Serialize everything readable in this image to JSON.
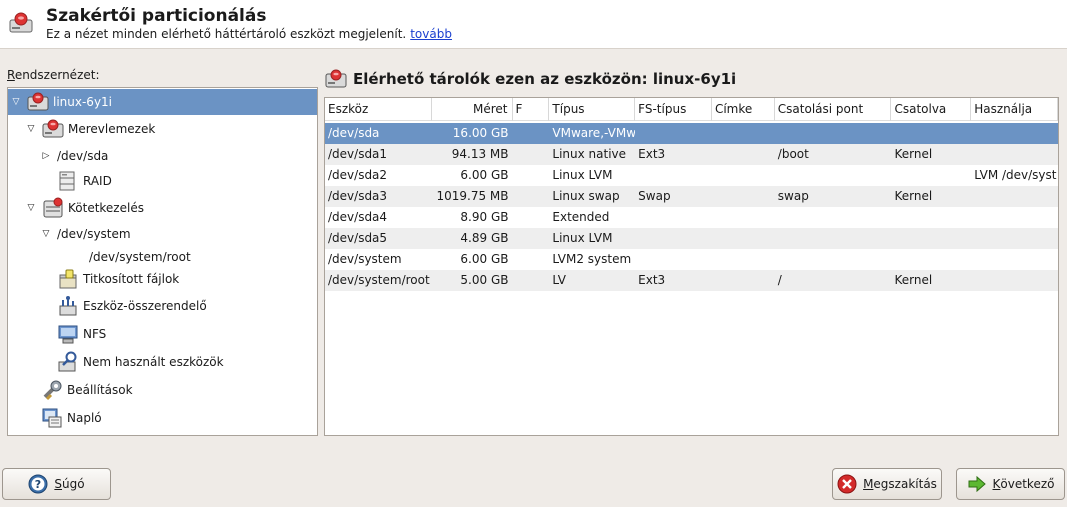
{
  "header": {
    "title": "Szakértői particionálás",
    "description": "Ez a nézet minden elérhető háttértároló eszközt megjelenít.",
    "more_link": "tovább"
  },
  "left": {
    "label_first": "R",
    "label_rest": "endszernézet:",
    "tree": [
      {
        "label": "linux-6y1i",
        "icon": "harddisk-icon",
        "expander": "expanded",
        "selected": true
      },
      {
        "label": "Merevlemezek",
        "icon": "harddisk-icon",
        "expander": "expanded"
      },
      {
        "label": "/dev/sda",
        "icon": "",
        "expander": "collapsed"
      },
      {
        "label": "RAID",
        "icon": "raid-icon",
        "expander": ""
      },
      {
        "label": "Kötetkezelés",
        "icon": "volume-manager-icon",
        "expander": "expanded"
      },
      {
        "label": "/dev/system",
        "icon": "",
        "expander": "expanded"
      },
      {
        "label": "/dev/system/root",
        "icon": "",
        "expander": ""
      },
      {
        "label": "Titkosított fájlok",
        "icon": "encrypted-files-icon",
        "expander": ""
      },
      {
        "label": "Eszköz-összerendelő",
        "icon": "device-mapper-icon",
        "expander": ""
      },
      {
        "label": "NFS",
        "icon": "nfs-icon",
        "expander": ""
      },
      {
        "label": "Nem használt eszközök",
        "icon": "unused-devices-icon",
        "expander": ""
      },
      {
        "label": "Beállítások",
        "icon": "settings-icon",
        "expander": ""
      },
      {
        "label": "Napló",
        "icon": "log-icon",
        "expander": ""
      }
    ]
  },
  "right": {
    "title": "Elérhető tárolók ezen az eszközön: linux-6y1i",
    "columns": [
      "Eszköz",
      "Méret",
      "F",
      "Típus",
      "FS-típus",
      "Címke",
      "Csatolási pont",
      "Csatolva",
      "Használja"
    ],
    "rows": [
      [
        "/dev/sda",
        "16.00 GB",
        "",
        "VMware,-VMw",
        "",
        "",
        "",
        "",
        ""
      ],
      [
        "/dev/sda1",
        "94.13 MB",
        "",
        "Linux native",
        "Ext3",
        "",
        "/boot",
        "Kernel",
        ""
      ],
      [
        "/dev/sda2",
        "6.00 GB",
        "",
        "Linux LVM",
        "",
        "",
        "",
        "",
        "LVM /dev/syst"
      ],
      [
        "/dev/sda3",
        "1019.75 MB",
        "",
        "Linux swap",
        "Swap",
        "",
        "swap",
        "Kernel",
        ""
      ],
      [
        "/dev/sda4",
        "8.90 GB",
        "",
        "Extended",
        "",
        "",
        "",
        "",
        ""
      ],
      [
        "/dev/sda5",
        "4.89 GB",
        "",
        "Linux LVM",
        "",
        "",
        "",
        "",
        ""
      ],
      [
        "/dev/system",
        "6.00 GB",
        "",
        "LVM2 system",
        "",
        "",
        "",
        "",
        ""
      ],
      [
        "/dev/system/root",
        "5.00 GB",
        "",
        "LV",
        "Ext3",
        "",
        "/",
        "Kernel",
        ""
      ]
    ],
    "selected_row": 0
  },
  "buttons": {
    "help_first": "S",
    "help_rest": "úgó",
    "abort_first": "M",
    "abort_rest": "egszakítás",
    "next_first": "K",
    "next_rest": "övetkező"
  },
  "colors": {
    "selection": "#6b93c4",
    "window_bg": "#efebe7"
  }
}
